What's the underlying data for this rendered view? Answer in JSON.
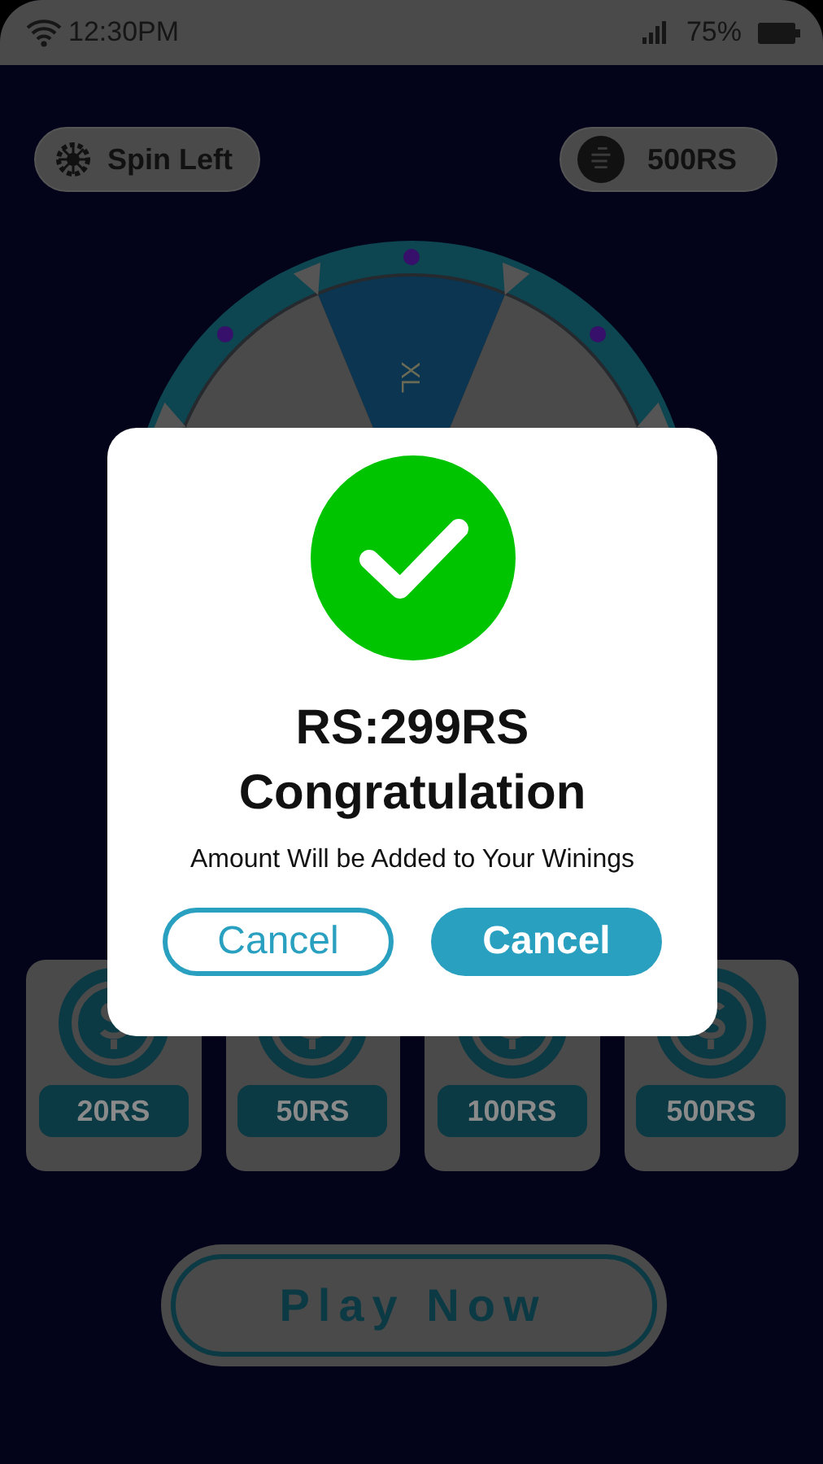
{
  "status_bar": {
    "time": "12:30PM",
    "battery": "75%"
  },
  "header": {
    "spins": {
      "label": "Spin Left"
    },
    "balance": {
      "label": "500RS"
    }
  },
  "wheel": {
    "segment_label": "XL"
  },
  "prizes": [
    {
      "label": "20RS"
    },
    {
      "label": "50RS"
    },
    {
      "label": "100RS"
    },
    {
      "label": "500RS"
    }
  ],
  "play_button": {
    "label": "Play Now"
  },
  "dialog": {
    "amount": "RS:299RS",
    "title": "Congratulation",
    "message": "Amount Will be Added to Your Winings",
    "buttons": [
      {
        "label": "Cancel",
        "kind": "outline"
      },
      {
        "label": "Cancel",
        "kind": "filled"
      }
    ]
  }
}
